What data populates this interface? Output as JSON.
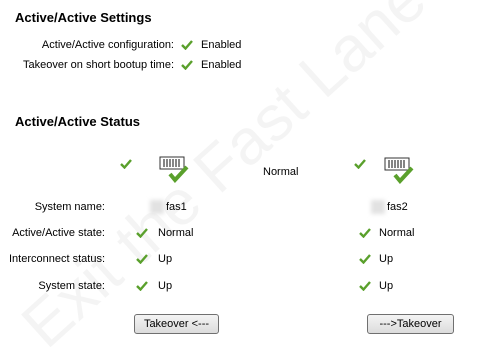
{
  "settings": {
    "title": "Active/Active Settings",
    "rows": [
      {
        "label": "Active/Active configuration:",
        "value": "Enabled"
      },
      {
        "label": "Takeover on short bootup time:",
        "value": "Enabled"
      }
    ]
  },
  "status": {
    "title": "Active/Active Status",
    "center_state": "Normal",
    "labels": {
      "system_name": "System name:",
      "aa_state": "Active/Active state:",
      "interconnect": "Interconnect status:",
      "system_state": "System state:"
    },
    "node1": {
      "system_name": "fas1",
      "aa_state": "Normal",
      "interconnect": "Up",
      "system_state": "Up"
    },
    "node2": {
      "system_name": "fas2",
      "aa_state": "Normal",
      "interconnect": "Up",
      "system_state": "Up"
    }
  },
  "buttons": {
    "takeover_left": "Takeover <---",
    "takeover_right": "--->Takeover"
  },
  "watermark": "Exit the Fast Lane",
  "colors": {
    "check": "#5aa02c"
  }
}
